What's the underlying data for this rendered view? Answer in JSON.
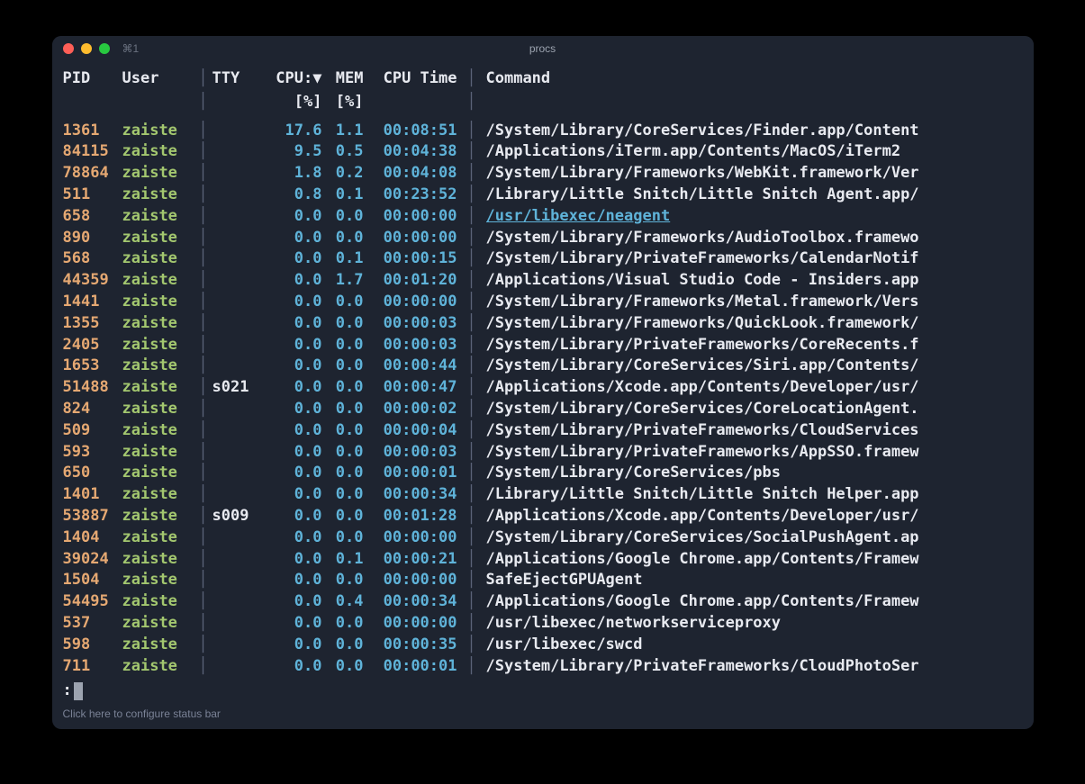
{
  "window": {
    "tab_label": "⌘1",
    "title": "procs"
  },
  "headers": {
    "pid": "PID",
    "user": "User",
    "tty": "TTY",
    "cpu": "CPU:",
    "cpu_arrow": "▼",
    "mem": "MEM",
    "time": "CPU Time",
    "cmd": "Command",
    "cpu_unit": "[%]",
    "mem_unit": "[%]"
  },
  "divider": "│",
  "rows": [
    {
      "pid": "1361",
      "user": "zaiste",
      "tty": "",
      "cpu": "17.6",
      "mem": "1.1",
      "time": "00:08:51",
      "cmd": "/System/Library/CoreServices/Finder.app/Content",
      "link": false
    },
    {
      "pid": "84115",
      "user": "zaiste",
      "tty": "",
      "cpu": "9.5",
      "mem": "0.5",
      "time": "00:04:38",
      "cmd": "/Applications/iTerm.app/Contents/MacOS/iTerm2",
      "link": false
    },
    {
      "pid": "78864",
      "user": "zaiste",
      "tty": "",
      "cpu": "1.8",
      "mem": "0.2",
      "time": "00:04:08",
      "cmd": "/System/Library/Frameworks/WebKit.framework/Ver",
      "link": false
    },
    {
      "pid": "511",
      "user": "zaiste",
      "tty": "",
      "cpu": "0.8",
      "mem": "0.1",
      "time": "00:23:52",
      "cmd": "/Library/Little Snitch/Little Snitch Agent.app/",
      "link": false
    },
    {
      "pid": "658",
      "user": "zaiste",
      "tty": "",
      "cpu": "0.0",
      "mem": "0.0",
      "time": "00:00:00",
      "cmd": "/usr/libexec/neagent",
      "link": true
    },
    {
      "pid": "890",
      "user": "zaiste",
      "tty": "",
      "cpu": "0.0",
      "mem": "0.0",
      "time": "00:00:00",
      "cmd": "/System/Library/Frameworks/AudioToolbox.framewo",
      "link": false
    },
    {
      "pid": "568",
      "user": "zaiste",
      "tty": "",
      "cpu": "0.0",
      "mem": "0.1",
      "time": "00:00:15",
      "cmd": "/System/Library/PrivateFrameworks/CalendarNotif",
      "link": false
    },
    {
      "pid": "44359",
      "user": "zaiste",
      "tty": "",
      "cpu": "0.0",
      "mem": "1.7",
      "time": "00:01:20",
      "cmd": "/Applications/Visual Studio Code - Insiders.app",
      "link": false
    },
    {
      "pid": "1441",
      "user": "zaiste",
      "tty": "",
      "cpu": "0.0",
      "mem": "0.0",
      "time": "00:00:00",
      "cmd": "/System/Library/Frameworks/Metal.framework/Vers",
      "link": false
    },
    {
      "pid": "1355",
      "user": "zaiste",
      "tty": "",
      "cpu": "0.0",
      "mem": "0.0",
      "time": "00:00:03",
      "cmd": "/System/Library/Frameworks/QuickLook.framework/",
      "link": false
    },
    {
      "pid": "2405",
      "user": "zaiste",
      "tty": "",
      "cpu": "0.0",
      "mem": "0.0",
      "time": "00:00:03",
      "cmd": "/System/Library/PrivateFrameworks/CoreRecents.f",
      "link": false
    },
    {
      "pid": "1653",
      "user": "zaiste",
      "tty": "",
      "cpu": "0.0",
      "mem": "0.0",
      "time": "00:00:44",
      "cmd": "/System/Library/CoreServices/Siri.app/Contents/",
      "link": false
    },
    {
      "pid": "51488",
      "user": "zaiste",
      "tty": "s021",
      "cpu": "0.0",
      "mem": "0.0",
      "time": "00:00:47",
      "cmd": "/Applications/Xcode.app/Contents/Developer/usr/",
      "link": false
    },
    {
      "pid": "824",
      "user": "zaiste",
      "tty": "",
      "cpu": "0.0",
      "mem": "0.0",
      "time": "00:00:02",
      "cmd": "/System/Library/CoreServices/CoreLocationAgent.",
      "link": false
    },
    {
      "pid": "509",
      "user": "zaiste",
      "tty": "",
      "cpu": "0.0",
      "mem": "0.0",
      "time": "00:00:04",
      "cmd": "/System/Library/PrivateFrameworks/CloudServices",
      "link": false
    },
    {
      "pid": "593",
      "user": "zaiste",
      "tty": "",
      "cpu": "0.0",
      "mem": "0.0",
      "time": "00:00:03",
      "cmd": "/System/Library/PrivateFrameworks/AppSSO.framew",
      "link": false
    },
    {
      "pid": "650",
      "user": "zaiste",
      "tty": "",
      "cpu": "0.0",
      "mem": "0.0",
      "time": "00:00:01",
      "cmd": "/System/Library/CoreServices/pbs",
      "link": false
    },
    {
      "pid": "1401",
      "user": "zaiste",
      "tty": "",
      "cpu": "0.0",
      "mem": "0.0",
      "time": "00:00:34",
      "cmd": "/Library/Little Snitch/Little Snitch Helper.app",
      "link": false
    },
    {
      "pid": "53887",
      "user": "zaiste",
      "tty": "s009",
      "cpu": "0.0",
      "mem": "0.0",
      "time": "00:01:28",
      "cmd": "/Applications/Xcode.app/Contents/Developer/usr/",
      "link": false
    },
    {
      "pid": "1404",
      "user": "zaiste",
      "tty": "",
      "cpu": "0.0",
      "mem": "0.0",
      "time": "00:00:00",
      "cmd": "/System/Library/CoreServices/SocialPushAgent.ap",
      "link": false
    },
    {
      "pid": "39024",
      "user": "zaiste",
      "tty": "",
      "cpu": "0.0",
      "mem": "0.1",
      "time": "00:00:21",
      "cmd": "/Applications/Google Chrome.app/Contents/Framew",
      "link": false
    },
    {
      "pid": "1504",
      "user": "zaiste",
      "tty": "",
      "cpu": "0.0",
      "mem": "0.0",
      "time": "00:00:00",
      "cmd": "SafeEjectGPUAgent",
      "link": false
    },
    {
      "pid": "54495",
      "user": "zaiste",
      "tty": "",
      "cpu": "0.0",
      "mem": "0.4",
      "time": "00:00:34",
      "cmd": "/Applications/Google Chrome.app/Contents/Framew",
      "link": false
    },
    {
      "pid": "537",
      "user": "zaiste",
      "tty": "",
      "cpu": "0.0",
      "mem": "0.0",
      "time": "00:00:00",
      "cmd": "/usr/libexec/networkserviceproxy",
      "link": false
    },
    {
      "pid": "598",
      "user": "zaiste",
      "tty": "",
      "cpu": "0.0",
      "mem": "0.0",
      "time": "00:00:35",
      "cmd": "/usr/libexec/swcd",
      "link": false
    },
    {
      "pid": "711",
      "user": "zaiste",
      "tty": "",
      "cpu": "0.0",
      "mem": "0.0",
      "time": "00:00:01",
      "cmd": "/System/Library/PrivateFrameworks/CloudPhotoSer",
      "link": false
    }
  ],
  "prompt": ":",
  "status_bar": "Click here to configure status bar"
}
